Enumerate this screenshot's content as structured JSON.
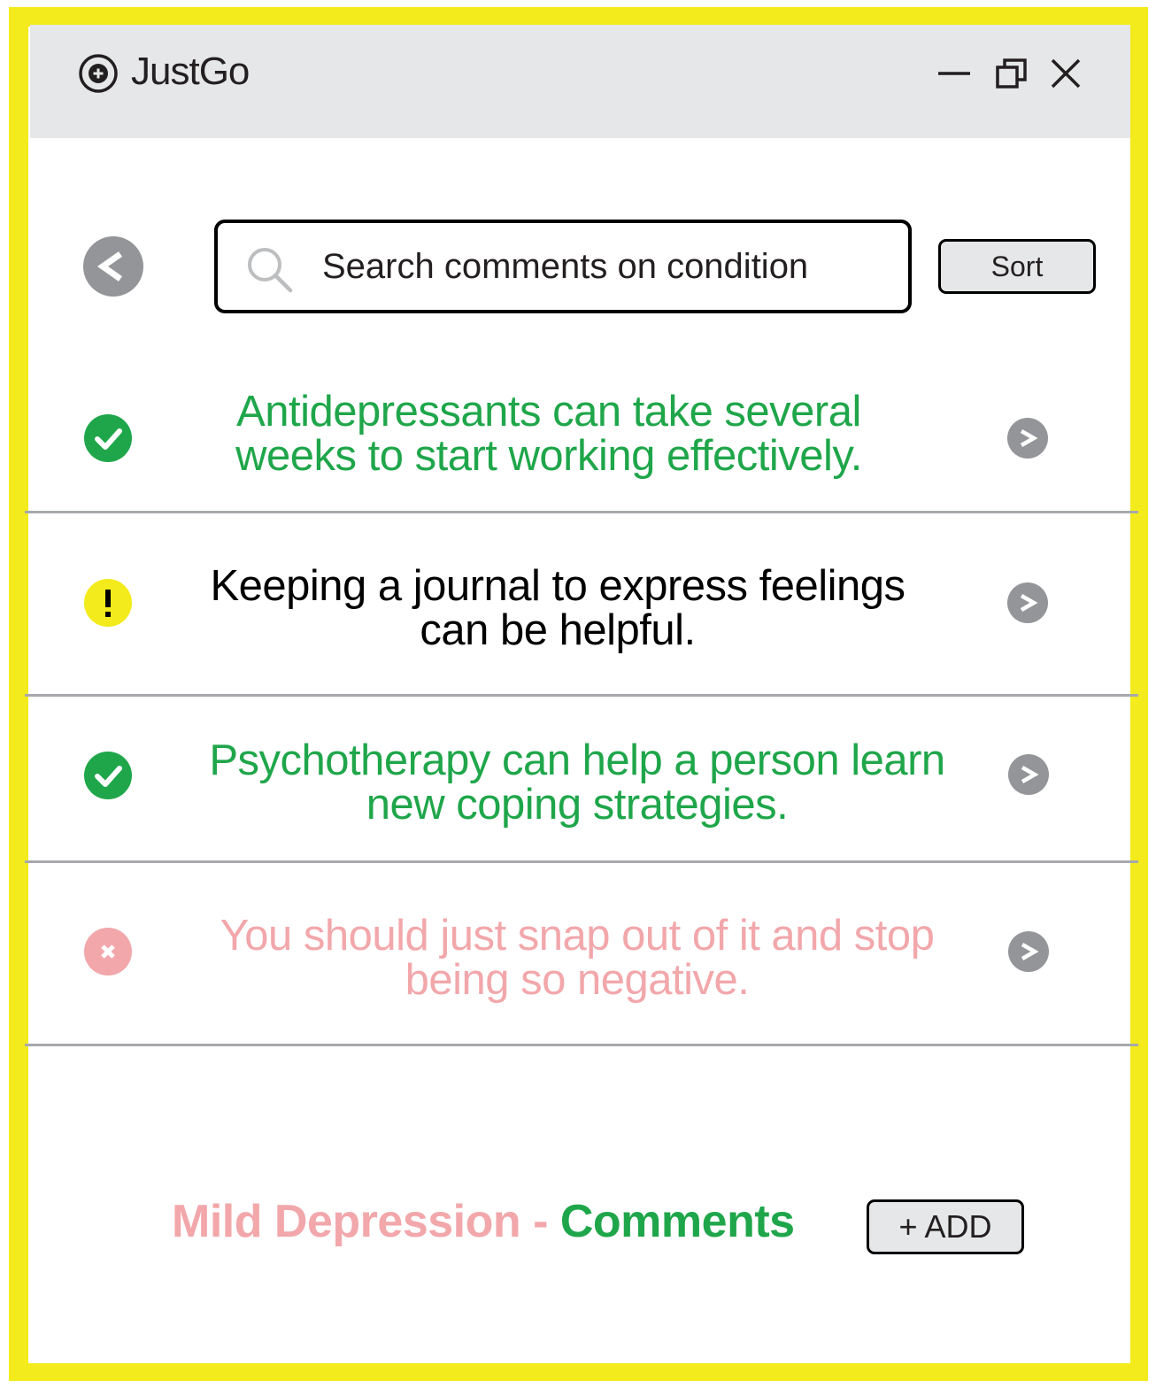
{
  "window": {
    "title": "JustGo",
    "logo_icon": "target-logo-icon",
    "controls": [
      "minimize-icon",
      "restore-icon",
      "close-icon"
    ]
  },
  "search": {
    "placeholder": "Search comments on condition",
    "value": ""
  },
  "toolbar": {
    "back_icon": "back-arrow-icon",
    "sort_label": "Sort"
  },
  "comments": [
    {
      "text": "Antidepressants can take several weeks to start working effectively.",
      "status": "verified",
      "icon": "check-circle-icon",
      "color": "#1fa64a"
    },
    {
      "text": "Keeping a journal to express feelings can be helpful.",
      "status": "caution",
      "icon": "exclamation-circle-icon",
      "color": "#000000"
    },
    {
      "text": "Psychotherapy can help a person learn new coping strategies.",
      "status": "verified",
      "icon": "check-circle-icon",
      "color": "#1fa64a"
    },
    {
      "text": "You should just snap out of it and stop being so negative.",
      "status": "rejected",
      "icon": "x-circle-icon",
      "color": "#f2a7ab"
    }
  ],
  "footer": {
    "condition": "Mild Depression",
    "separator": " - ",
    "section": "Comments",
    "add_label": "+ ADD"
  },
  "colors": {
    "frame": "#f3eb1b",
    "titlebar": "#e6e7e8",
    "green": "#1fa64a",
    "pink": "#f2a7ab",
    "yellow": "#f3eb1b",
    "gray": "#939598"
  }
}
